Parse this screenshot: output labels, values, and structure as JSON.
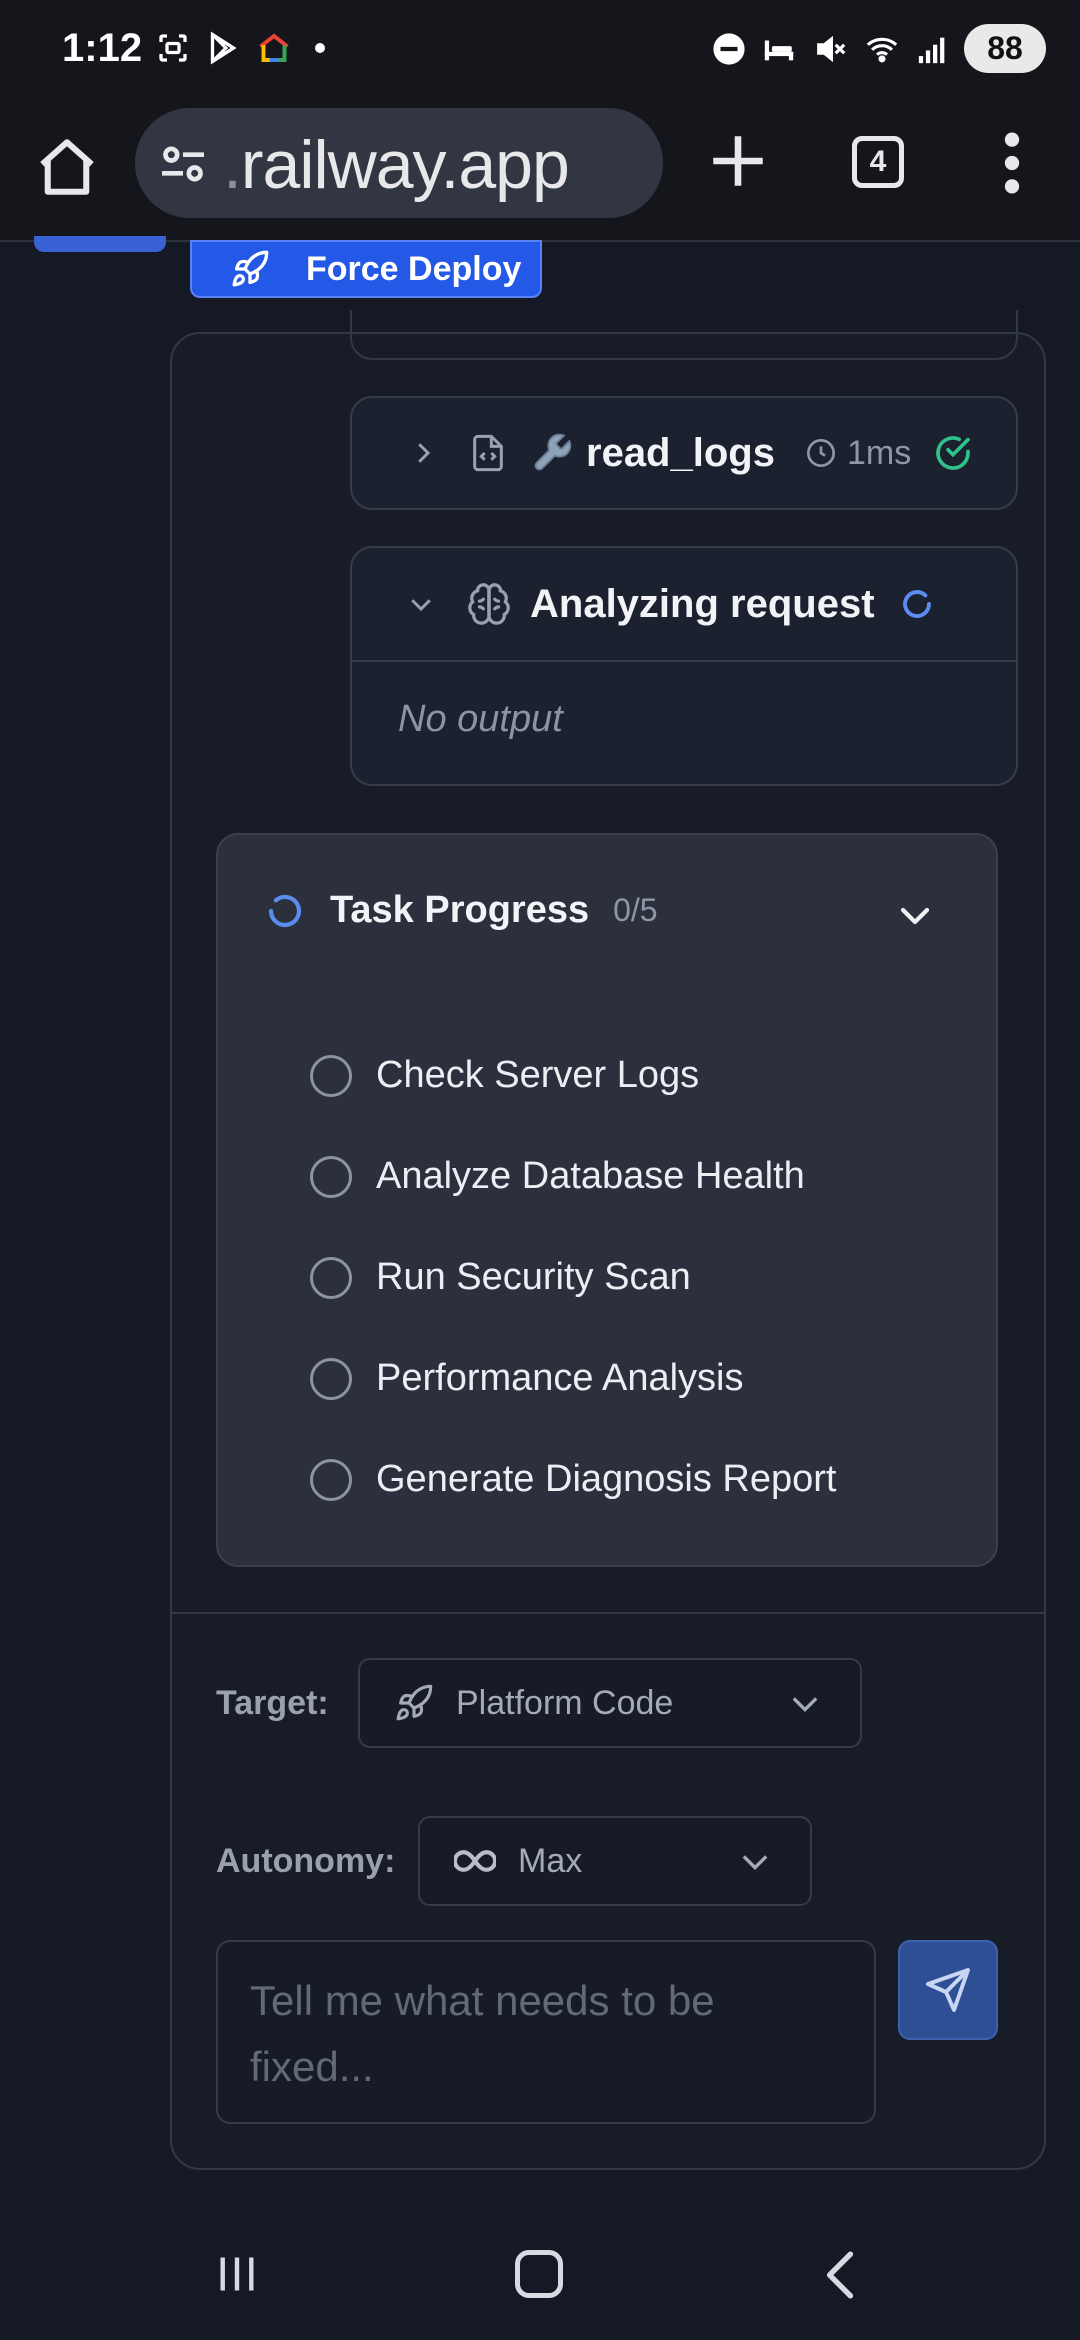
{
  "status_bar": {
    "time": "1:12",
    "battery": "88",
    "network": "6"
  },
  "browser": {
    "url_prefix": ".",
    "url": "railway.app",
    "tab_count": "4"
  },
  "header": {
    "force_deploy_label": "Force Deploy"
  },
  "tool_call": {
    "name": "read_logs",
    "duration": "1ms",
    "status": "success"
  },
  "analyzing": {
    "title": "Analyzing request",
    "output": "No output"
  },
  "task_progress": {
    "title": "Task Progress",
    "count": "0/5",
    "items": [
      {
        "label": "Check Server Logs",
        "done": false
      },
      {
        "label": "Analyze Database Health",
        "done": false
      },
      {
        "label": "Run Security Scan",
        "done": false
      },
      {
        "label": "Performance Analysis",
        "done": false
      },
      {
        "label": "Generate Diagnosis Report",
        "done": false
      }
    ]
  },
  "controls": {
    "target_label": "Target:",
    "target_value": "Platform Code",
    "autonomy_label": "Autonomy:",
    "autonomy_value": "Max",
    "input_placeholder": "Tell me what needs to be fixed..."
  },
  "colors": {
    "accent_blue": "#2458e6",
    "success_green": "#2fc28a",
    "spinner_blue": "#5b8cf0"
  }
}
